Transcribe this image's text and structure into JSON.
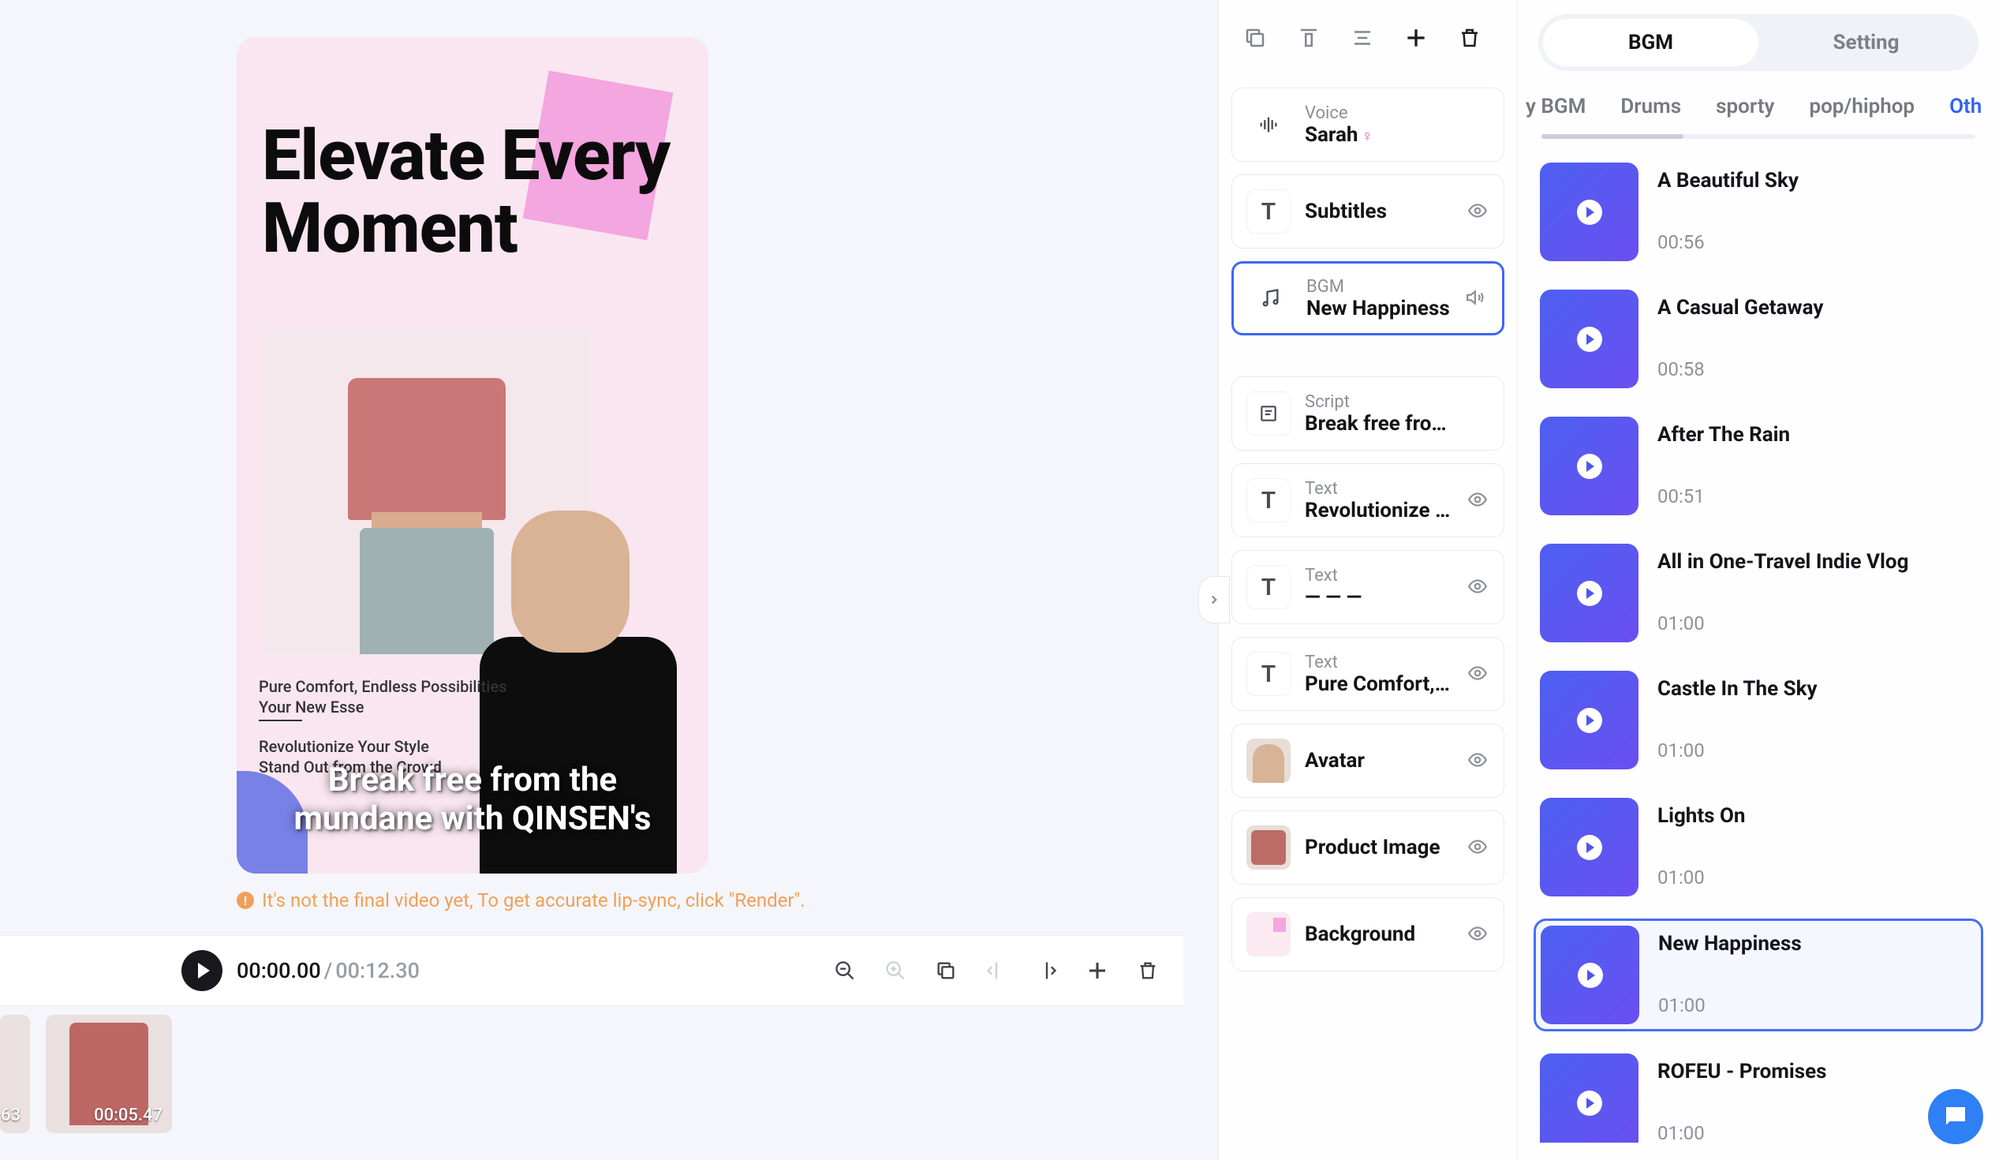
{
  "canvas": {
    "headline": "Elevate Every Moment",
    "tagline_a": "Pure Comfort, Endless Possibilities",
    "tagline_b": "Your New Esse",
    "tagline_c": "Revolutionize Your Style",
    "tagline_d": "Stand Out from the Crowd",
    "subtitle_overlay": "Break free from the mundane with QINSEN's",
    "render_notice": "It's not the final video yet, To get accurate lip-sync, click \"Render\"."
  },
  "player": {
    "current": "00:00.00",
    "total": "00:12.30"
  },
  "timeline": {
    "clips": [
      {
        "duration": "63"
      },
      {
        "duration": "00:05.47"
      }
    ]
  },
  "layers": {
    "voice": {
      "label": "Voice",
      "value": "Sarah"
    },
    "subtitles": {
      "value": "Subtitles"
    },
    "bgm": {
      "label": "BGM",
      "value": "New Happiness"
    },
    "script": {
      "label": "Script",
      "value": "Break free fro…"
    },
    "text1": {
      "label": "Text",
      "value": "Revolutionize …"
    },
    "text2": {
      "label": "Text",
      "value": "— — —"
    },
    "text3": {
      "label": "Text",
      "value": "Pure Comfort,…"
    },
    "avatar": {
      "value": "Avatar"
    },
    "product": {
      "value": "Product Image"
    },
    "background": {
      "value": "Background"
    }
  },
  "right_panel": {
    "tabs": {
      "bgm": "BGM",
      "setting": "Setting"
    },
    "categories": [
      "y BGM",
      "Drums",
      "sporty",
      "pop/hiphop",
      "Oth"
    ],
    "active_category_index": 4,
    "tracks": [
      {
        "title": "A Beautiful Sky",
        "time": "00:56"
      },
      {
        "title": "A Casual Getaway",
        "time": "00:58"
      },
      {
        "title": "After The Rain",
        "time": "00:51"
      },
      {
        "title": "All in One-Travel Indie Vlog",
        "time": "01:00"
      },
      {
        "title": "Castle In The Sky",
        "time": "01:00"
      },
      {
        "title": "Lights On",
        "time": "01:00"
      },
      {
        "title": "New Happiness",
        "time": "01:00"
      },
      {
        "title": "ROFEU - Promises",
        "time": "01:00"
      }
    ],
    "selected_track_index": 6
  }
}
